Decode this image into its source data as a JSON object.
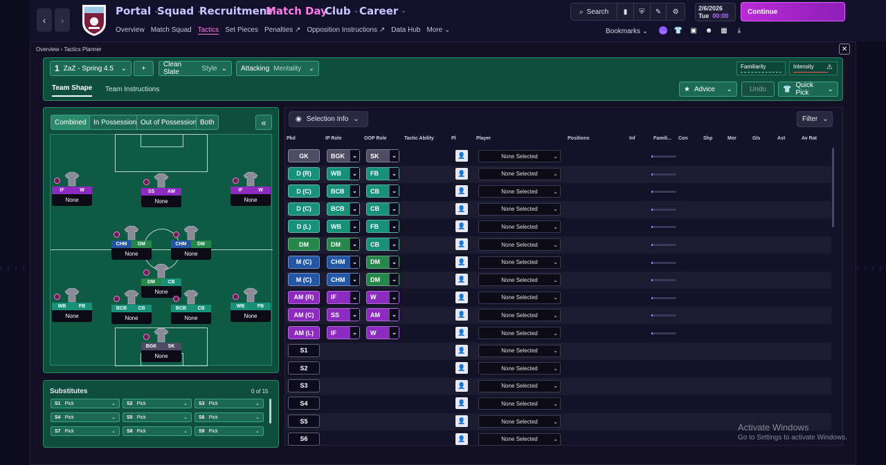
{
  "nav": {
    "menus": [
      {
        "label": "Portal",
        "color": "#c9c6ff"
      },
      {
        "label": "Squad",
        "color": "#c9c6ff"
      },
      {
        "label": "Recruitment",
        "color": "#c9c6ff"
      },
      {
        "label": "Match Day",
        "color": "#ff7be9"
      },
      {
        "label": "Club",
        "color": "#c9c6ff"
      },
      {
        "label": "Career",
        "color": "#c9c6ff"
      }
    ],
    "submenu": [
      "Overview",
      "Match Squad",
      "Tactics",
      "Set Pieces",
      "Penalties",
      "Opposition Instructions",
      "Data Hub",
      "More"
    ],
    "search_label": "Search",
    "date": "2/6/2026",
    "day": "Tue",
    "time": "00:00",
    "continue_label": "Continue",
    "bookmarks_label": "Bookmarks",
    "accent": "#b82ad6"
  },
  "breadcrumb": {
    "root": "Overview",
    "current": "Tactics Planner"
  },
  "tactic": {
    "slot": "1",
    "name": "ZaZ - Spring 4.5",
    "add": "+",
    "style_value": "Clean Slate",
    "style_label": "Style",
    "mentality_value": "Attacking",
    "mentality_label": "Mentality",
    "familiarity_label": "Familiarity",
    "intensity_label": "Intensity",
    "tabs": [
      "Team Shape",
      "Team Instructions"
    ],
    "advice_label": "Advice",
    "undo_label": "Undo",
    "quickpick_label": "Quick Pick"
  },
  "view_buttons": [
    "Combined",
    "In Possession",
    "Out of Possession",
    "Both"
  ],
  "collapse_icon": "«",
  "pitch_players": [
    {
      "ip": "IF",
      "oop": "W",
      "ipc": "r-purple",
      "oopc": "r-purple",
      "name": "None"
    },
    {
      "ip": "SS",
      "oop": "AM",
      "ipc": "r-purple",
      "oopc": "r-purple",
      "name": "None"
    },
    {
      "ip": "IF",
      "oop": "W",
      "ipc": "r-purple",
      "oopc": "r-purple",
      "name": "None"
    },
    {
      "ip": "CHM",
      "oop": "DM",
      "ipc": "r-blue",
      "oopc": "r-green",
      "name": "None"
    },
    {
      "ip": "CHM",
      "oop": "DM",
      "ipc": "r-blue",
      "oopc": "r-green",
      "name": "None"
    },
    {
      "ip": "DM",
      "oop": "CB",
      "ipc": "r-green",
      "oopc": "r-teal",
      "name": "None"
    },
    {
      "ip": "WB",
      "oop": "FB",
      "ipc": "r-teal",
      "oopc": "r-teal",
      "name": "None"
    },
    {
      "ip": "BCB",
      "oop": "CB",
      "ipc": "r-teal",
      "oopc": "r-teal",
      "name": "None"
    },
    {
      "ip": "BCB",
      "oop": "CB",
      "ipc": "r-teal",
      "oopc": "r-teal",
      "name": "None"
    },
    {
      "ip": "WB",
      "oop": "FB",
      "ipc": "r-teal",
      "oopc": "r-teal",
      "name": "None"
    },
    {
      "ip": "BGK",
      "oop": "SK",
      "ipc": "r-grey",
      "oopc": "r-grey",
      "name": "None"
    }
  ],
  "substitutes": {
    "title": "Substitutes",
    "count": "0 of 15",
    "slots": [
      {
        "id": "S1",
        "label": "Pick"
      },
      {
        "id": "S2",
        "label": "Pick"
      },
      {
        "id": "S3",
        "label": "Pick"
      },
      {
        "id": "S4",
        "label": "Pick"
      },
      {
        "id": "S5",
        "label": "Pick"
      },
      {
        "id": "S6",
        "label": "Pick"
      },
      {
        "id": "S7",
        "label": "Pick"
      },
      {
        "id": "S8",
        "label": "Pick"
      },
      {
        "id": "S9",
        "label": "Pick"
      }
    ]
  },
  "selection_info_label": "Selection Info",
  "filter_label": "Filter",
  "table_headers": [
    "Pkd",
    "IP Role",
    "OOP Role",
    "Tactic Ability",
    "Pl",
    "Player",
    "Positions",
    "Inf",
    "Famili...",
    "Con",
    "Shp",
    "Mor",
    "Gls",
    "Ast",
    "Av Rat"
  ],
  "rows": [
    {
      "pos": "GK",
      "pc": "#4f4d66",
      "ip": "BGK",
      "ipc": "#4f4d66",
      "oop": "SK",
      "oopc": "#4f4d66",
      "player": "None Selected"
    },
    {
      "pos": "D (R)",
      "pc": "#17917a",
      "ip": "WB",
      "ipc": "#17917a",
      "oop": "FB",
      "oopc": "#17917a",
      "player": "None Selected"
    },
    {
      "pos": "D (C)",
      "pc": "#17917a",
      "ip": "BCB",
      "ipc": "#17917a",
      "oop": "CB",
      "oopc": "#17917a",
      "player": "None Selected"
    },
    {
      "pos": "D (C)",
      "pc": "#17917a",
      "ip": "BCB",
      "ipc": "#17917a",
      "oop": "CB",
      "oopc": "#17917a",
      "player": "None Selected"
    },
    {
      "pos": "D (L)",
      "pc": "#17917a",
      "ip": "WB",
      "ipc": "#17917a",
      "oop": "FB",
      "oopc": "#17917a",
      "player": "None Selected"
    },
    {
      "pos": "DM",
      "pc": "#25884a",
      "ip": "DM",
      "ipc": "#25884a",
      "oop": "CB",
      "oopc": "#17917a",
      "player": "None Selected"
    },
    {
      "pos": "M (C)",
      "pc": "#2357a6",
      "ip": "CHM",
      "ipc": "#2357a6",
      "oop": "DM",
      "oopc": "#25884a",
      "player": "None Selected"
    },
    {
      "pos": "M (C)",
      "pc": "#2357a6",
      "ip": "CHM",
      "ipc": "#2357a6",
      "oop": "DM",
      "oopc": "#25884a",
      "player": "None Selected"
    },
    {
      "pos": "AM (R)",
      "pc": "#8d2bc0",
      "ip": "IF",
      "ipc": "#8d2bc0",
      "oop": "W",
      "oopc": "#8d2bc0",
      "player": "None Selected"
    },
    {
      "pos": "AM (C)",
      "pc": "#8d2bc0",
      "ip": "SS",
      "ipc": "#8d2bc0",
      "oop": "AM",
      "oopc": "#8d2bc0",
      "player": "None Selected"
    },
    {
      "pos": "AM (L)",
      "pc": "#8d2bc0",
      "ip": "IF",
      "ipc": "#8d2bc0",
      "oop": "W",
      "oopc": "#8d2bc0",
      "player": "None Selected"
    },
    {
      "pos": "S1",
      "pc": "#0d0b1e",
      "player": "None Selected"
    },
    {
      "pos": "S2",
      "pc": "#0d0b1e",
      "player": "None Selected"
    },
    {
      "pos": "S3",
      "pc": "#0d0b1e",
      "player": "None Selected"
    },
    {
      "pos": "S4",
      "pc": "#0d0b1e",
      "player": "None Selected"
    },
    {
      "pos": "S5",
      "pc": "#0d0b1e",
      "player": "None Selected"
    },
    {
      "pos": "S6",
      "pc": "#0d0b1e",
      "player": "None Selected"
    }
  ],
  "watermark": {
    "line1": "Activate Windows",
    "line2": "Go to Settings to activate Windows."
  }
}
